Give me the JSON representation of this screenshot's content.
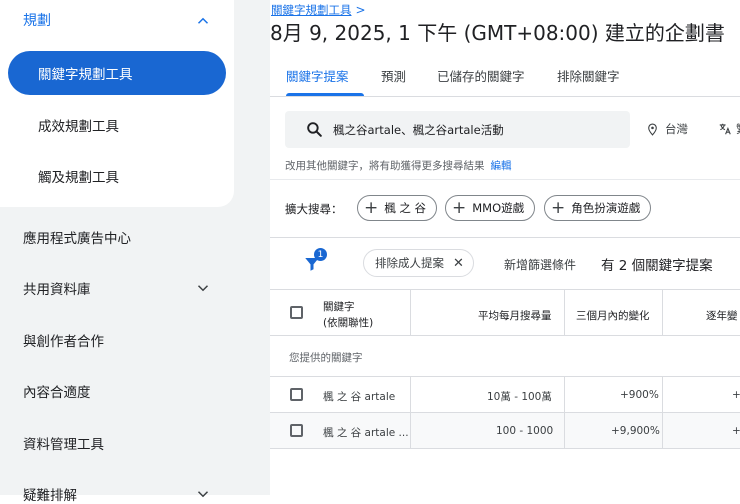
{
  "sidebar": {
    "group_title": "規劃",
    "group_items": [
      {
        "label": "關鍵字規劃工具",
        "active": true
      },
      {
        "label": "成效規劃工具",
        "active": false
      },
      {
        "label": "觸及規劃工具",
        "active": false
      }
    ],
    "nav": [
      {
        "label": "應用程式廣告中心",
        "expandable": false
      },
      {
        "label": "共用資料庫",
        "expandable": true
      },
      {
        "label": "與創作者合作",
        "expandable": false
      },
      {
        "label": "內容合適度",
        "expandable": false
      },
      {
        "label": "資料管理工具",
        "expandable": false
      },
      {
        "label": "疑難排解",
        "expandable": true
      }
    ]
  },
  "header": {
    "breadcrumb": "關鍵字規劃工具",
    "breadcrumb_arrow": ">",
    "title": "8月 9, 2025, 1 下午 (GMT+08:00) 建立的企劃書"
  },
  "tabs": [
    "關鍵字提案",
    "預測",
    "已儲存的關鍵字",
    "排除關鍵字"
  ],
  "search": {
    "query": "楓之谷artale、楓之谷artale活動",
    "location": "台灣",
    "language": "繁"
  },
  "hint": {
    "text": "改用其他關鍵字，將有助獲得更多搜尋結果",
    "link": "編輯"
  },
  "expand": {
    "label": "擴大搜尋：",
    "chips": [
      "楓 之 谷",
      "MMO遊戲",
      "角色扮演遊戲"
    ]
  },
  "filter": {
    "badge": "1",
    "chip": "排除成人提案",
    "add_filter": "新增篩選條件",
    "count_text": "有 2 個關鍵字提案"
  },
  "table": {
    "headers": {
      "keyword_line1": "關鍵字",
      "keyword_line2": "(依關聯性)",
      "avg_searches": "平均每月搜尋量",
      "three_month": "三個月內的變化",
      "yoy": "逐年變"
    },
    "section_label": "您提供的關鍵字",
    "rows": [
      {
        "keyword": "楓 之 谷 artale",
        "avg": "10萬 - 100萬",
        "three_month": "+900%",
        "yoy": "+"
      },
      {
        "keyword": "楓 之 谷 artale ...",
        "avg": "100 - 1000",
        "three_month": "+9,900%",
        "yoy": "+"
      }
    ]
  },
  "colors": {
    "accent": "#1a73e8",
    "active_nav": "#1967d2",
    "sidebar_bg": "#f1f3f4"
  },
  "icons": [
    "chevron-up-icon",
    "chevron-down-icon",
    "search-icon",
    "location-pin-icon",
    "translate-icon",
    "plus-icon",
    "filter-icon",
    "close-icon",
    "checkbox-icon"
  ]
}
